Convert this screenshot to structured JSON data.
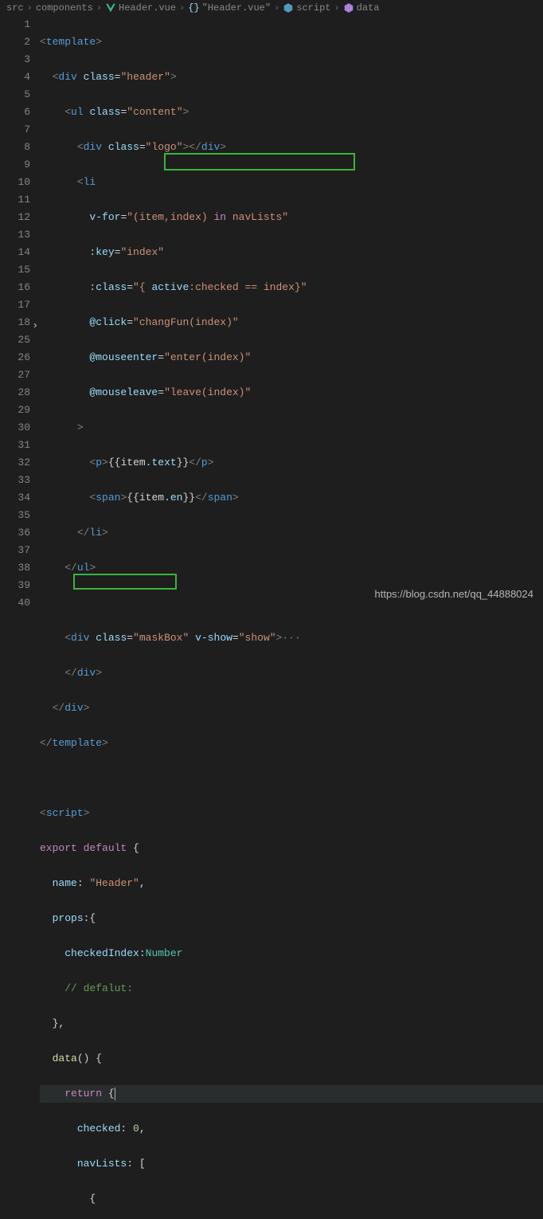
{
  "breadcrumb": {
    "p1": "src",
    "p2": "components",
    "p3": "Header.vue",
    "p4": "\"Header.vue\"",
    "p5": "script",
    "p6": "data"
  },
  "lines": {
    "l1": "1",
    "l2": "2",
    "l3": "3",
    "l4": "4",
    "l5": "5",
    "l6": "6",
    "l7": "7",
    "l8": "8",
    "l9": "9",
    "l10": "10",
    "l11": "11",
    "l12": "12",
    "l13": "13",
    "l14": "14",
    "l15": "15",
    "l16": "16",
    "l17": "17",
    "l18": "18",
    "l25": "25",
    "l26": "26",
    "l27": "27",
    "l28": "28",
    "l29": "29",
    "l30": "30",
    "l31": "31",
    "l32": "32",
    "l33": "33",
    "l34": "34",
    "l35": "35",
    "l36": "36",
    "l37": "37",
    "l38": "38",
    "l39": "39",
    "l40": "40"
  },
  "code": {
    "template_open": "template",
    "div": "div",
    "ul": "ul",
    "li": "li",
    "p": "p",
    "span": "span",
    "class": "class",
    "header": "\"header\"",
    "content": "\"content\"",
    "logo": "\"logo\"",
    "vfor": "v-for",
    "vfor_val": "\"(item,index) ",
    "in": "in",
    "navLists": " navLists\"",
    "key": ":key",
    "key_val": "\"index\"",
    "bclass": ":class",
    "bclass_l": "\"{ ",
    "active": "active",
    "bclass_r": ":checked == index}\"",
    "click": "@click",
    "click_val": "\"changFun(index)\"",
    "menter": "@mouseenter",
    "menter_val": "\"enter(index)\"",
    "mleave": "@mouseleave",
    "mleave_val": "\"leave(index)\"",
    "gt": ">",
    "item_text": "{{item.text}}",
    "item_en": "{{item.en}}",
    "maskBox": "\"maskBox\"",
    "vshow": "v-show",
    "show": "\"show\"",
    "dots": "···",
    "script": "script",
    "export": "export",
    "default": "default",
    "lb": "{",
    "rb": "}",
    "name": "name",
    "header_str": "\"Header\"",
    "props": "props",
    "checkedIndex": "checkedIndex",
    "Number": "Number",
    "comment": "// defalut:",
    "data": "data",
    "paren": "()",
    "return": "return",
    "checked": "checked",
    "zero": "0",
    "navListsKey": "navLists",
    "lbracket": "[",
    "comma": ",",
    "colon": ":"
  },
  "watermark": "https://blog.csdn.net/qq_44888024"
}
